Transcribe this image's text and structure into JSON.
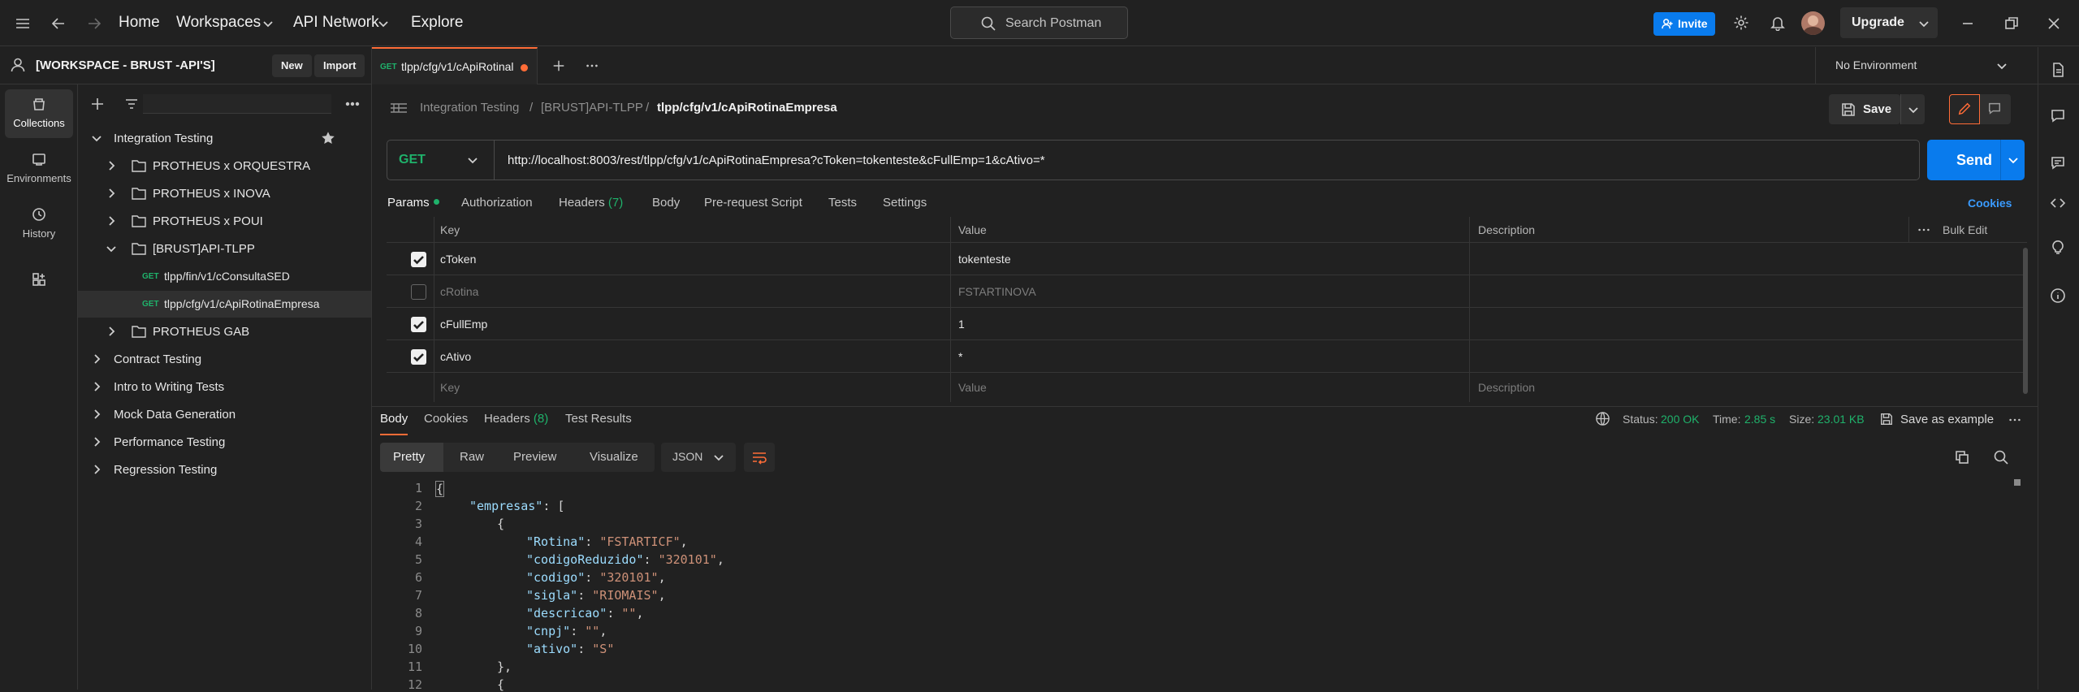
{
  "topbar": {
    "nav": [
      "Home",
      "Workspaces",
      "API Network",
      "Explore"
    ],
    "search_placeholder": "Search Postman",
    "invite_label": "Invite",
    "upgrade_label": "Upgrade"
  },
  "workspace": {
    "title": "[WORKSPACE - BRUST -API'S]",
    "new_label": "New",
    "import_label": "Import"
  },
  "rail": [
    {
      "label": "Collections",
      "icon": "collections-icon"
    },
    {
      "label": "Environments",
      "icon": "environments-icon"
    },
    {
      "label": "History",
      "icon": "history-icon"
    },
    {
      "label": "",
      "icon": "add-apps-icon"
    }
  ],
  "tree": {
    "root": "Integration Testing",
    "folders": [
      "PROTHEUS x ORQUESTRA",
      "PROTHEUS x INOVA",
      "PROTHEUS x POUI",
      "[BRUST]API-TLPP"
    ],
    "requests": [
      {
        "method": "GET",
        "name": "tlpp/fin/v1/cConsultaSED"
      },
      {
        "method": "GET",
        "name": "tlpp/cfg/v1/cApiRotinaEmpresa"
      }
    ],
    "folder_after": "PROTHEUS GAB",
    "collections": [
      "Contract Testing",
      "Intro to Writing Tests",
      "Mock Data Generation",
      "Performance Testing",
      "Regression Testing"
    ]
  },
  "tab": {
    "method": "GET",
    "name": "tlpp/cfg/v1/cApiRotinal"
  },
  "environment": "No Environment",
  "breadcrumb": [
    "Integration Testing",
    "[BRUST]API-TLPP",
    "tlpp/cfg/v1/cApiRotinaEmpresa"
  ],
  "save_label": "Save",
  "request": {
    "method": "GET",
    "url": "http://localhost:8003/rest/tlpp/cfg/v1/cApiRotinaEmpresa?cToken=tokenteste&cFullEmp=1&cAtivo=*",
    "send_label": "Send"
  },
  "request_tabs": [
    "Params",
    "Authorization",
    "Headers",
    "(7)",
    "Body",
    "Pre-request Script",
    "Tests",
    "Settings"
  ],
  "cookies_label": "Cookies",
  "params": {
    "headers": [
      "Key",
      "Value",
      "Description"
    ],
    "bulk_edit": "Bulk Edit",
    "rows": [
      {
        "key": "cToken",
        "value": "tokenteste",
        "enabled": true
      },
      {
        "key": "cRotina",
        "value": "FSTARTINOVA",
        "enabled": false
      },
      {
        "key": "cFullEmp",
        "value": "1",
        "enabled": true
      },
      {
        "key": "cAtivo",
        "value": "*",
        "enabled": true
      }
    ],
    "placeholder": {
      "key": "Key",
      "value": "Value",
      "description": "Description"
    }
  },
  "response": {
    "tabs": [
      "Body",
      "Cookies",
      "Headers",
      "(8)",
      "Test Results"
    ],
    "status_label": "Status:",
    "status": "200 OK",
    "time_label": "Time:",
    "time": "2.85 s",
    "size_label": "Size:",
    "size": "23.01 KB",
    "save_example": "Save as example",
    "formats": [
      "Pretty",
      "Raw",
      "Preview",
      "Visualize"
    ],
    "lang": "JSON"
  },
  "code": {
    "line_numbers": [
      "1",
      "2",
      "3",
      "4",
      "5",
      "6",
      "7",
      "8",
      "9",
      "10",
      "11",
      "12"
    ],
    "l1": "{",
    "l2k": "\"empresas\"",
    "l2p": ": [",
    "l3": "{",
    "l4k": "\"Rotina\"",
    "l4v": "\"FSTARTICF\"",
    "l5k": "\"codigoReduzido\"",
    "l5v": "\"320101\"",
    "l6k": "\"codigo\"",
    "l6v": "\"320101\"",
    "l7k": "\"sigla\"",
    "l7v": "\"RIOMAIS\"",
    "l8k": "\"descricao\"",
    "l8v": "\"\"",
    "l9k": "\"cnpj\"",
    "l9v": "\"\"",
    "l10k": "\"ativo\"",
    "l10v": "\"S\"",
    "l11": "},",
    "l12": "{"
  }
}
